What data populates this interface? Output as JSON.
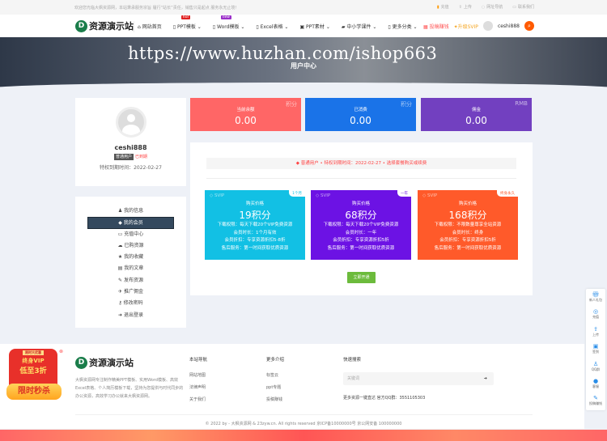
{
  "topbar": {
    "welcome": "欢迎您光临大枫资源网，本站秉承服务宗旨 履行“站长”责任，销售只是起点 服务永无止境！",
    "links": [
      "充值",
      "上传",
      "网址导航",
      "联系我们"
    ]
  },
  "nav": {
    "logo": "资源演示站",
    "items": [
      "网站首页",
      "PPT模板",
      "Word模板",
      "Excel表格",
      "PPT素材",
      "中小学课件",
      "更多分类"
    ],
    "badges": {
      "hot": "hot",
      "new": "new"
    },
    "promote": "投稿赚钱",
    "svip": "升级SVIP",
    "user": "ceshi888"
  },
  "banner": {
    "watermark": "https://www.huzhan.com/ishop663",
    "title": "用户中心"
  },
  "profile": {
    "name": "ceshi888",
    "role": "普通用户",
    "status": "已到期",
    "expire": "特权到期时间：2022-02-27"
  },
  "sidebar": [
    "我的信息",
    "我的会员",
    "充值中心",
    "已购资源",
    "我的收藏",
    "我的文章",
    "发布资源",
    "推广佣金",
    "修改密码",
    "退出登录"
  ],
  "stats": [
    {
      "label": "当前余额",
      "value": "0.00",
      "unit": "积分",
      "color": "#ff6666"
    },
    {
      "label": "已消费",
      "value": "0.00",
      "unit": "积分",
      "color": "#1a73e8"
    },
    {
      "label": "佣金",
      "value": "0.00",
      "unit": "RMB",
      "color": "#7240c0"
    }
  ],
  "notice": "普通用户 • 特权到期时间：2022-02-27 • 选择套餐购买或续费",
  "plans": [
    {
      "tag": "SVIP",
      "corner": "1个月",
      "head": "购买价格",
      "price": "19积分",
      "lines": [
        "下载权限：每天下载20个VIP免费资源",
        "会员时长：1个月有效",
        "会员折扣：专享资源折扣5-8折",
        "售后服务：第一时间获取优质资源"
      ],
      "color": "#12c0e4"
    },
    {
      "tag": "SVIP",
      "corner": "一年",
      "head": "购买价格",
      "price": "68积分",
      "lines": [
        "下载权限：每天下载20个VIP免费资源",
        "会员时长：一年",
        "会员折扣：专享资源折扣5折",
        "售后服务：第一时间获取优质资源"
      ],
      "color": "#6c12e4"
    },
    {
      "tag": "SVIP",
      "corner": "终身永久",
      "head": "购买价格",
      "price": "168积分",
      "lines": [
        "下载权限：不限数量尊享全站资源",
        "会员时长：终身",
        "会员折扣：专享资源折扣5折",
        "售后服务：第一时间获取优质资源"
      ],
      "color": "#ff5a2a"
    }
  ],
  "open_button": "立即开通",
  "float": [
    "新人礼包",
    "充值",
    "上传",
    "签到",
    "QQ群",
    "客服",
    "投稿赚钱"
  ],
  "promo": {
    "top": "限时大优惠",
    "line1": "终身VIP",
    "line2": "低至3折",
    "button": "限时秒杀"
  },
  "footer": {
    "logo": "资源演示站",
    "desc": "大枫资源网专注制作精美PPT模板、实用Word模板、高效Excel表格、个人简历模板下载，坚持为您提供与时代同步的办公资源，高效学习办公就来大枫资源网。",
    "col1": {
      "title": "本站导航",
      "links": [
        "网站地图",
        "法律声明",
        "关于我们"
      ]
    },
    "col2": {
      "title": "更多介绍",
      "links": [
        "标签云",
        "ppt专题",
        "投稿赚钱"
      ]
    },
    "col3": {
      "title": "快速搜索",
      "placeholder": "关键词",
      "note": "更多资源一键直达 官方QQ群：3551105303"
    },
    "copyright": "© 2022 by - 大枫资源网 & 23zyw.cn. All rights reserved  京ICP备10000000号  京公网安备 100000000"
  }
}
